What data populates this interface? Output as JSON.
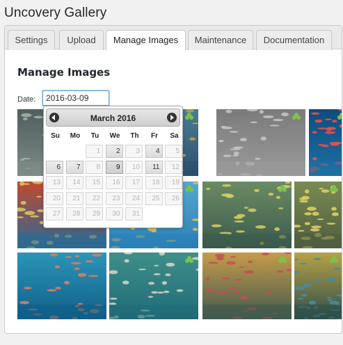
{
  "page": {
    "title": "Uncovery Gallery"
  },
  "tabs": [
    {
      "label": "Settings",
      "active": false
    },
    {
      "label": "Upload",
      "active": false
    },
    {
      "label": "Manage Images",
      "active": true
    },
    {
      "label": "Maintenance",
      "active": false
    },
    {
      "label": "Documentation",
      "active": false
    }
  ],
  "main": {
    "title": "Manage Images",
    "date_label": "Date:",
    "date_value": "2016-03-09"
  },
  "datepicker": {
    "month_title": "March 2016",
    "weekdays": [
      "Su",
      "Mo",
      "Tu",
      "We",
      "Th",
      "Fr",
      "Sa"
    ],
    "weeks": [
      [
        "",
        "",
        "1",
        "2",
        "3",
        "4",
        "5"
      ],
      [
        "6",
        "7",
        "8",
        "9",
        "10",
        "11",
        "12"
      ],
      [
        "13",
        "14",
        "15",
        "16",
        "17",
        "18",
        "19"
      ],
      [
        "20",
        "21",
        "22",
        "23",
        "24",
        "25",
        "26"
      ],
      [
        "27",
        "28",
        "29",
        "30",
        "31",
        "",
        ""
      ]
    ],
    "enabled_days": [
      "2",
      "4",
      "6",
      "7",
      "9",
      "11"
    ],
    "selected_day": "9"
  },
  "images": [
    {
      "scene": "turtle",
      "palette": [
        "#7e8c88",
        "#4f5f5e",
        "#aab2a8"
      ]
    },
    {
      "scene": "reef-fish",
      "palette": [
        "#2d4f6e",
        "#4a7d93",
        "#c7a13a"
      ]
    },
    {
      "scene": "gray-texture",
      "palette": [
        "#9a9a9a",
        "#7b7b7b",
        "#c8c8c8"
      ]
    },
    {
      "scene": "red-fish-school",
      "palette": [
        "#1e6fa4",
        "#0f4c7d",
        "#e8524c"
      ]
    },
    {
      "scene": "coral-wall",
      "palette": [
        "#2c6a93",
        "#c0492f",
        "#d8c86a"
      ]
    },
    {
      "scene": "green-reef",
      "palette": [
        "#1c7a9a",
        "#2f9b82",
        "#9ec25b"
      ]
    },
    {
      "scene": "blue-water",
      "palette": [
        "#2a81b8",
        "#56a6cf",
        "#e6c04d"
      ]
    },
    {
      "scene": "yellow-school",
      "palette": [
        "#1f6788",
        "#3b8fb0",
        "#f0d24a"
      ]
    },
    {
      "scene": "fish-swarm",
      "palette": [
        "#3b5a4d",
        "#6b8b63",
        "#dccf62"
      ]
    },
    {
      "scene": "yellow-stripes",
      "palette": [
        "#4f5e3f",
        "#7a8a52",
        "#e3d366"
      ]
    },
    {
      "scene": "diver-fan",
      "palette": [
        "#0f5f88",
        "#2c95b8",
        "#e07e5c"
      ]
    },
    {
      "scene": "spotted-fish",
      "palette": [
        "#1f6c78",
        "#3f8f8a",
        "#d9d7c4"
      ]
    },
    {
      "scene": "pufferfish",
      "palette": [
        "#3f5a4e",
        "#c69b4a",
        "#c24d5b"
      ]
    },
    {
      "scene": "yellow-fish",
      "palette": [
        "#2d4e4a",
        "#b8a246",
        "#4c8a9c"
      ]
    }
  ],
  "icons": {
    "gallery": "clover-icon",
    "prev": "circle-arrow-left-icon",
    "next": "circle-arrow-right-icon"
  }
}
